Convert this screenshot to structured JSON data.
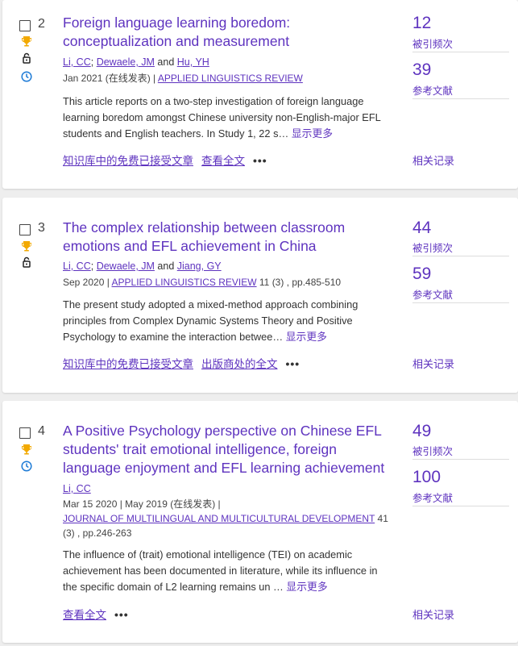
{
  "records": [
    {
      "index": "2",
      "title_lines": [
        "Foreign language learning boredom:",
        "conceptualization and measurement"
      ],
      "authors": [
        {
          "name": "Li, CC",
          "sep": "; "
        },
        {
          "name": "Dewaele, JM",
          "sep": " and "
        },
        {
          "name": "Hu, YH",
          "sep": ""
        }
      ],
      "date": "Jan 2021 (在线发表) | ",
      "journal": "APPLIED LINGUISTICS REVIEW",
      "journal_suffix": "",
      "abstract_lines": [
        "This article reports on a two-step investigation of foreign language",
        "learning boredom amongst Chinese university non-English-major EFL",
        "students and English teachers. In Study 1, 22 s…"
      ],
      "show_more": "显示更多",
      "links": [
        "知识库中的免费已接受文章",
        "查看全文"
      ],
      "citations": "12",
      "citations_label": "被引频次",
      "references": "39",
      "references_label": "参考文献",
      "related": "相关记录"
    },
    {
      "index": "3",
      "title_lines": [
        "The complex relationship between classroom",
        "emotions and EFL achievement in China"
      ],
      "authors": [
        {
          "name": "Li, CC",
          "sep": "; "
        },
        {
          "name": "Dewaele, JM",
          "sep": " and "
        },
        {
          "name": "Jiang, GY",
          "sep": ""
        }
      ],
      "date": "Sep 2020 | ",
      "journal": "APPLIED LINGUISTICS REVIEW",
      "journal_suffix": " 11 (3) , pp.485-510",
      "abstract_lines": [
        "The present study adopted a mixed-method approach combining",
        "principles from Complex Dynamic Systems Theory and Positive",
        "Psychology to examine the interaction betwee…"
      ],
      "show_more": "显示更多",
      "links": [
        "知识库中的免费已接受文章",
        "出版商处的全文"
      ],
      "citations": "44",
      "citations_label": "被引频次",
      "references": "59",
      "references_label": "参考文献",
      "related": "相关记录"
    },
    {
      "index": "4",
      "title_lines": [
        "A Positive Psychology perspective on Chinese EFL",
        "students' trait emotional intelligence, foreign",
        "language enjoyment and EFL learning achievement"
      ],
      "authors": [
        {
          "name": "Li, CC",
          "sep": ""
        }
      ],
      "date": "Mar 15 2020 | May 2019 (在线发表) |",
      "journal": "JOURNAL OF MULTILINGUAL AND MULTICULTURAL DEVELOPMENT",
      "journal_suffix": " 41 (3) , pp.246-263",
      "abstract_lines": [
        "The influence of (trait) emotional intelligence (TEI) on academic",
        "achievement has been documented in literature, while its influence in",
        "the specific domain of L2 learning remains un …"
      ],
      "show_more": "显示更多",
      "links": [
        "查看全文"
      ],
      "citations": "49",
      "citations_label": "被引频次",
      "references": "100",
      "references_label": "参考文献",
      "related": "相关记录"
    }
  ],
  "colors": {
    "accent": "#5e33bf",
    "trophy": "#f2a900",
    "clock": "#1e7bd6",
    "background": "#eeeeee"
  },
  "icons": [
    "checkbox",
    "trophy-icon",
    "unlock-icon",
    "clock-icon",
    "more-options-icon"
  ]
}
